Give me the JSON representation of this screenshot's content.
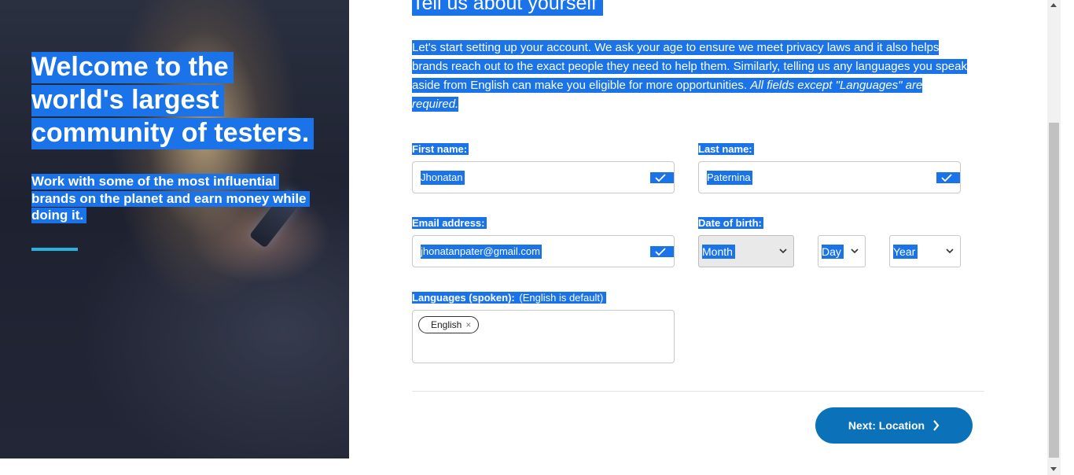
{
  "hero": {
    "title": "Welcome to the world's largest community of testers.",
    "subtitle": "Work with some of the most influential brands on the planet and earn money while doing it.",
    "accent_color": "#2bb3e0"
  },
  "form": {
    "title": "Tell us about yourself",
    "intro": "Let's start setting up your account. We ask your age to ensure we meet privacy laws and it also helps brands reach out to the exact people they need to help them. Similarly, telling us any languages you speak aside from English can make you eligible for more opportunities.",
    "intro_note": "All fields except \"Languages\" are required.",
    "first_name": {
      "label": "First name:",
      "value": "Jhonatan",
      "valid_icon": "check-icon"
    },
    "last_name": {
      "label": "Last name:",
      "value": "Paternina",
      "valid_icon": "check-icon"
    },
    "email": {
      "label": "Email address:",
      "value": "jhonatanpater@gmail.com",
      "valid_icon": "check-icon"
    },
    "dob": {
      "label": "Date of birth:",
      "month": "Month",
      "day": "Day",
      "year": "Year"
    },
    "languages": {
      "label": "Languages (spoken):",
      "hint": "(English is default)",
      "chips": [
        "English"
      ],
      "remove_symbol": "×"
    },
    "next_button": {
      "label": "Next: Location",
      "color": "#0b72b9"
    }
  },
  "selection_color": "#1a73e8"
}
